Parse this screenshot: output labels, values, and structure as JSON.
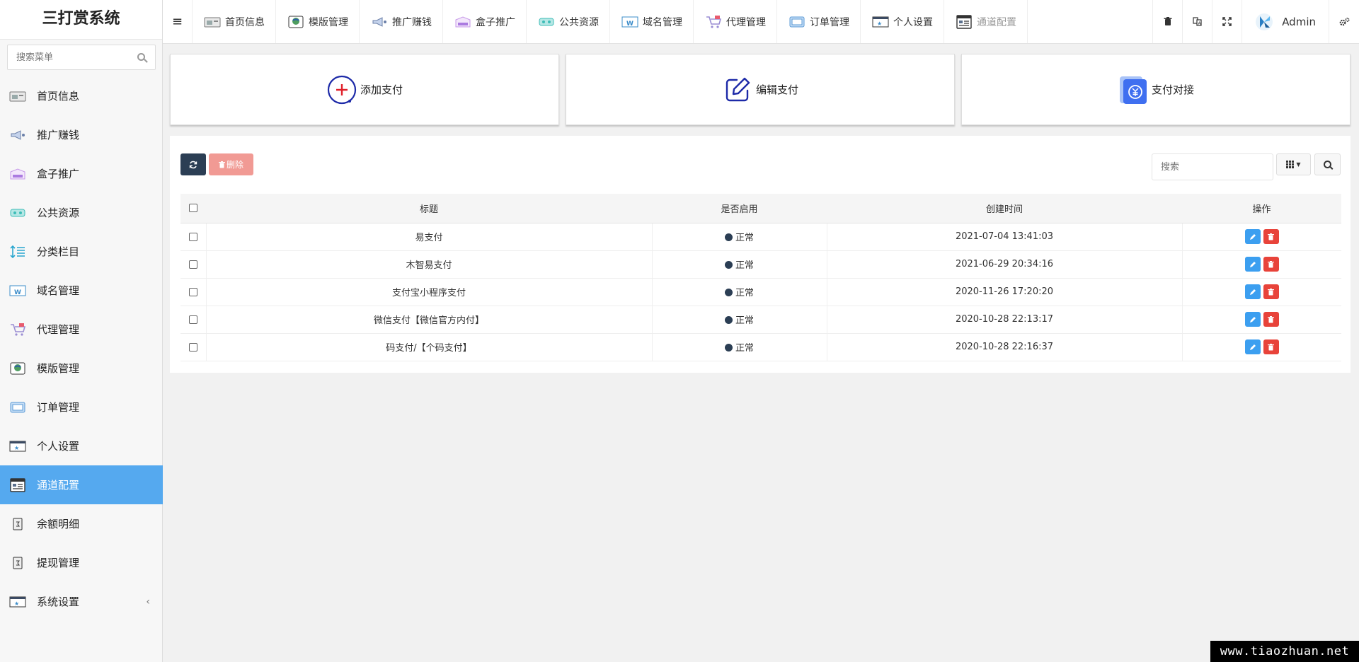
{
  "app": {
    "title": "三打赏系统"
  },
  "sidebar": {
    "search_placeholder": "搜索菜单",
    "items": [
      {
        "label": "首页信息",
        "icon": "home-card-icon"
      },
      {
        "label": "推广赚钱",
        "icon": "megaphone-icon"
      },
      {
        "label": "盒子推广",
        "icon": "box-icon"
      },
      {
        "label": "公共资源",
        "icon": "resource-icon"
      },
      {
        "label": "分类栏目",
        "icon": "sort-list-icon"
      },
      {
        "label": "域名管理",
        "icon": "domain-icon"
      },
      {
        "label": "代理管理",
        "icon": "cart-icon"
      },
      {
        "label": "模版管理",
        "icon": "template-icon"
      },
      {
        "label": "订单管理",
        "icon": "order-icon"
      },
      {
        "label": "个人设置",
        "icon": "profile-icon"
      },
      {
        "label": "通道配置",
        "icon": "channel-icon"
      },
      {
        "label": "余额明细",
        "icon": "balance-icon"
      },
      {
        "label": "提现管理",
        "icon": "withdraw-icon"
      },
      {
        "label": "系统设置",
        "icon": "system-icon",
        "arrow": "‹"
      }
    ],
    "active_index": 10
  },
  "topbar": {
    "tabs": [
      {
        "label": "首页信息"
      },
      {
        "label": "模版管理"
      },
      {
        "label": "推广赚钱"
      },
      {
        "label": "盒子推广"
      },
      {
        "label": "公共资源"
      },
      {
        "label": "域名管理"
      },
      {
        "label": "代理管理"
      },
      {
        "label": "订单管理"
      },
      {
        "label": "个人设置"
      },
      {
        "label": "通道配置"
      }
    ],
    "user": "Admin"
  },
  "cards": [
    {
      "label": "添加支付"
    },
    {
      "label": "编辑支付"
    },
    {
      "label": "支付对接"
    }
  ],
  "toolbar": {
    "delete_label": "删除",
    "search_placeholder": "搜索"
  },
  "table": {
    "columns": [
      "标题",
      "是否启用",
      "创建时间",
      "操作"
    ],
    "rows": [
      {
        "title": "易支付",
        "status": "正常",
        "created": "2021-07-04 13:41:03"
      },
      {
        "title": "木智易支付",
        "status": "正常",
        "created": "2021-06-29 20:34:16"
      },
      {
        "title": "支付宝小程序支付",
        "status": "正常",
        "created": "2020-11-26 17:20:20"
      },
      {
        "title": "微信支付【微信官方内付】",
        "status": "正常",
        "created": "2020-10-28 22:13:17"
      },
      {
        "title": "码支付/【个码支付】",
        "status": "正常",
        "created": "2020-10-28 22:16:37"
      }
    ]
  },
  "watermark": "www.tiaozhuan.net",
  "colors": {
    "accent": "#55a9ef",
    "dark": "#2b3e54",
    "danger": "#e8433a",
    "edit": "#3c9ff0"
  }
}
